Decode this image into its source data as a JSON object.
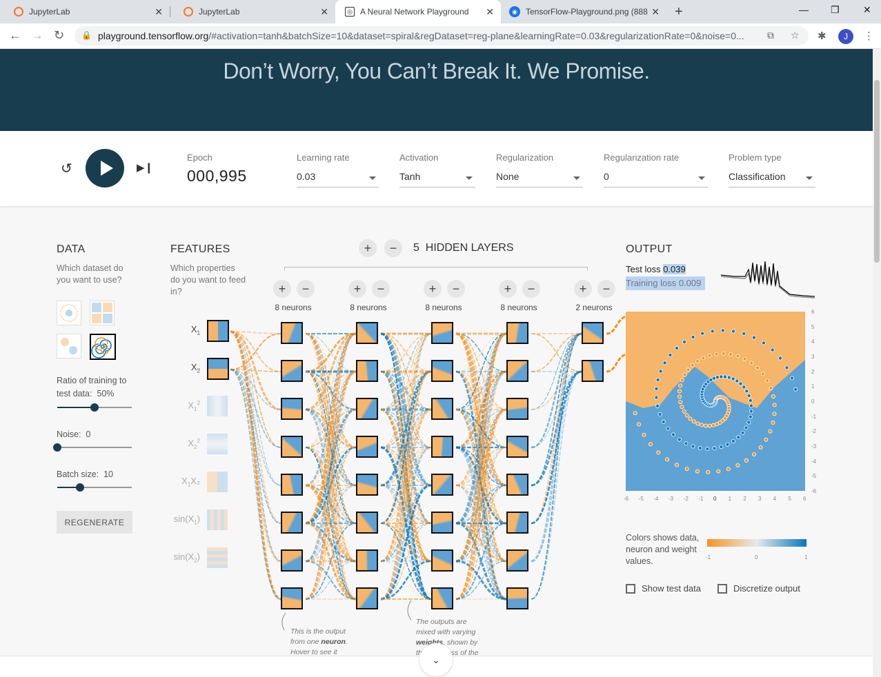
{
  "browser": {
    "tabs": [
      {
        "title": "JupyterLab",
        "active": false
      },
      {
        "title": "JupyterLab",
        "active": false
      },
      {
        "title": "A Neural Network Playground",
        "active": true
      },
      {
        "title": "TensorFlow-Playground.png (888",
        "active": false
      }
    ],
    "url_host": "playground.tensorflow.org",
    "url_rest": "/#activation=tanh&batchSize=10&dataset=spiral&regDataset=reg-plane&learningRate=0.03&regularizationRate=0&noise=0...",
    "profile_initial": "J"
  },
  "hero": {
    "tagline": "Don’t Worry, You Can’t Break It. We Promise."
  },
  "controls": {
    "epoch_label": "Epoch",
    "epoch_value": "000,995",
    "learning_rate": {
      "label": "Learning rate",
      "value": "0.03"
    },
    "activation": {
      "label": "Activation",
      "value": "Tanh"
    },
    "regularization": {
      "label": "Regularization",
      "value": "None"
    },
    "regularization_rate": {
      "label": "Regularization rate",
      "value": "0"
    },
    "problem_type": {
      "label": "Problem type",
      "value": "Classification"
    }
  },
  "data_panel": {
    "title": "DATA",
    "subtitle": "Which dataset do you want to use?",
    "ratio_label": "Ratio of training to test data:",
    "ratio_value": "50%",
    "ratio_fraction": 0.5,
    "noise_label": "Noise:",
    "noise_value": "0",
    "noise_fraction": 0,
    "batch_label": "Batch size:",
    "batch_value": "10",
    "batch_fraction": 0.31,
    "regenerate_label": "REGENERATE",
    "selected_dataset": "spiral"
  },
  "features": {
    "title": "FEATURES",
    "subtitle": "Which properties do you want to feed in?",
    "items": [
      {
        "base": "X",
        "sub": "1",
        "sup": "",
        "suffix": "",
        "active": true
      },
      {
        "base": "X",
        "sub": "2",
        "sup": "",
        "suffix": "",
        "active": true
      },
      {
        "base": "X",
        "sub": "1",
        "sup": "2",
        "suffix": "",
        "active": false
      },
      {
        "base": "X",
        "sub": "2",
        "sup": "2",
        "suffix": "",
        "active": false
      },
      {
        "base": "X",
        "sub": "1",
        "sup": "",
        "suffix": "X₂",
        "active": false
      },
      {
        "base": "sin(X",
        "sub": "1",
        "sup": "",
        "suffix": ")",
        "active": false
      },
      {
        "base": "sin(X",
        "sub": "2",
        "sup": "",
        "suffix": ")",
        "active": false
      }
    ]
  },
  "hidden": {
    "count": "5",
    "label": "HIDDEN LAYERS",
    "layers": [
      {
        "neurons_label": "8 neurons",
        "neurons": 8
      },
      {
        "neurons_label": "8 neurons",
        "neurons": 8
      },
      {
        "neurons_label": "8 neurons",
        "neurons": 8
      },
      {
        "neurons_label": "8 neurons",
        "neurons": 8
      },
      {
        "neurons_label": "2 neurons",
        "neurons": 2
      }
    ],
    "note_neuron": "This is the output from one neuron. Hover to see it larger.",
    "note_neuron_a": "This is the output from one ",
    "note_neuron_b": "neuron",
    "note_neuron_c": ". Hover to see it larger.",
    "note_weights_a": "The outputs are mixed with varying ",
    "note_weights_b": "weights",
    "note_weights_c": ", shown by the thickness of the lines."
  },
  "output": {
    "title": "OUTPUT",
    "test_loss_label": "Test loss",
    "test_loss_value": "0.039",
    "training_loss_label": "Training loss",
    "training_loss_value": "0.009",
    "x_ticks": [
      "-6",
      "-5",
      "-4",
      "-3",
      "-2",
      "-1",
      "0",
      "1",
      "2",
      "3",
      "4",
      "5",
      "6"
    ],
    "y_ticks": [
      "6",
      "5",
      "4",
      "3",
      "2",
      "1",
      "0",
      "-1",
      "-2",
      "-3",
      "-4",
      "-5",
      "-6"
    ],
    "legend_text": "Colors shows data, neuron and weight values.",
    "legend_ticks": [
      "-1",
      "0",
      "1"
    ],
    "show_test_label": "Show test data",
    "discretize_label": "Discretize output"
  },
  "colors": {
    "orange": "#f59322",
    "blue": "#0877bd",
    "light_orange": "#f5b56a",
    "light_blue": "#5fa2d4",
    "header_bg": "#183d4e"
  }
}
